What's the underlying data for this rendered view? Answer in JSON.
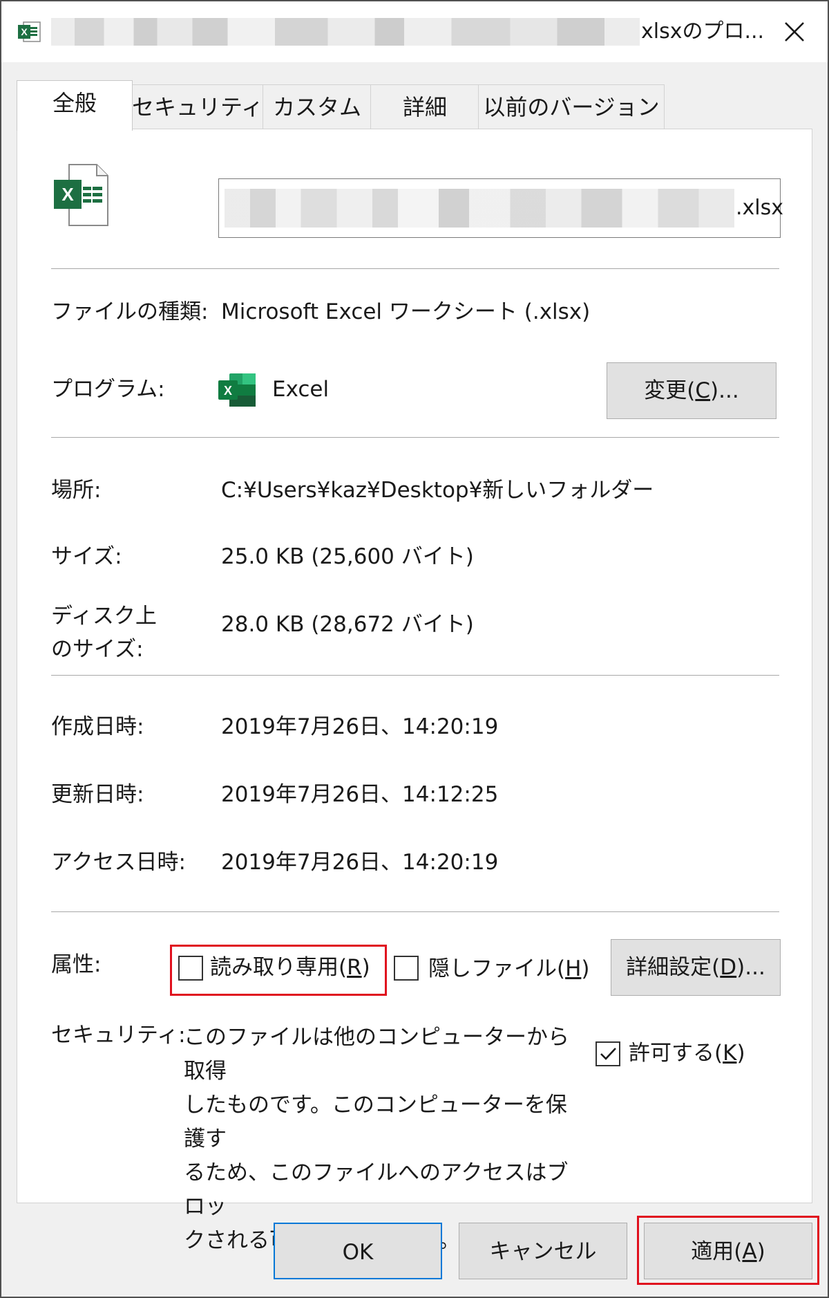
{
  "window": {
    "title_suffix": "xlsxのプロ...",
    "close_glyph": "✕"
  },
  "tabs": [
    {
      "label": "全般",
      "active": true
    },
    {
      "label": "セキュリティ"
    },
    {
      "label": "カスタム"
    },
    {
      "label": "詳細"
    },
    {
      "label": "以前のバージョン"
    }
  ],
  "file": {
    "name_extension": ".xlsx",
    "icon": "excel-file-icon"
  },
  "properties": {
    "type_label": "ファイルの種類:",
    "type_value": "Microsoft Excel ワークシート (.xlsx)",
    "program_label": "プログラム:",
    "program_value": "Excel",
    "change_button": {
      "pre": "変更(",
      "key": "C",
      "post": ")..."
    },
    "location_label": "場所:",
    "location_value": "C:¥Users¥kaz¥Desktop¥新しいフォルダー",
    "size_label": "サイズ:",
    "size_value": "25.0 KB (25,600 バイト)",
    "disk_size_label_1": "ディスク上",
    "disk_size_label_2": "のサイズ:",
    "disk_size_value": "28.0 KB (28,672 バイト)",
    "created_label": "作成日時:",
    "created_value": "2019年7月26日、14:20:19",
    "modified_label": "更新日時:",
    "modified_value": "2019年7月26日、14:12:25",
    "accessed_label": "アクセス日時:",
    "accessed_value": "2019年7月26日、14:20:19"
  },
  "attributes": {
    "label": "属性:",
    "readonly": {
      "pre": "読み取り専用(",
      "key": "R",
      "post": ")",
      "checked": false
    },
    "hidden": {
      "pre": "隠しファイル(",
      "key": "H",
      "post": ")",
      "checked": false
    },
    "advanced_button": {
      "pre": "詳細設定(",
      "key": "D",
      "post": ")..."
    }
  },
  "security": {
    "label": "セキュリティ:",
    "lines": [
      "このファイルは他のコンピューターから取得",
      "したものです。このコンピューターを保護す",
      "るため、このファイルへのアクセスはブロッ",
      "クされる可能性があります。"
    ],
    "allow": {
      "pre": "許可する(",
      "key": "K",
      "post": ")",
      "checked": true
    }
  },
  "footer": {
    "ok": "OK",
    "cancel": "キャンセル",
    "apply": {
      "pre": "適用(",
      "key": "A",
      "post": ")"
    }
  },
  "colors": {
    "excel_green": "#1d6f42",
    "highlight_red": "#e0101e",
    "focus_blue": "#0078d7"
  }
}
